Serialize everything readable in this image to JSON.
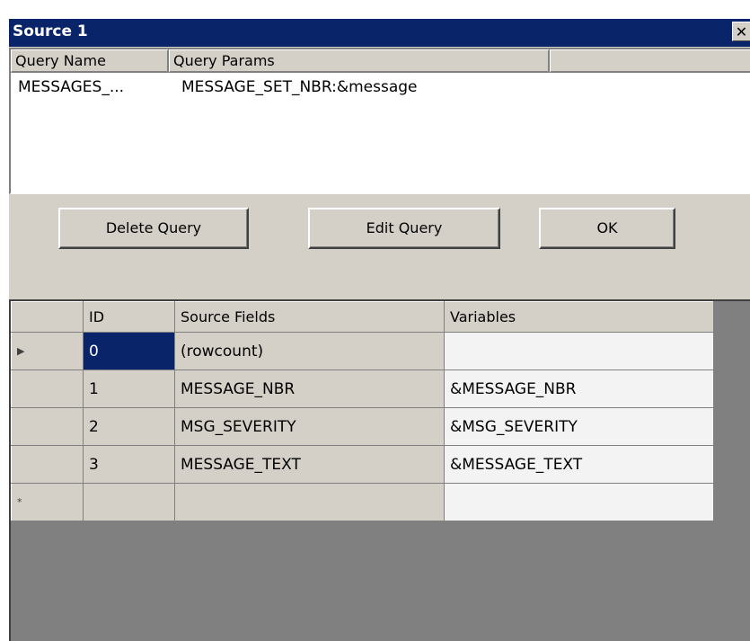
{
  "window": {
    "title": "Source 1",
    "close_glyph": "✕"
  },
  "query_list": {
    "columns": [
      "Query Name",
      "Query Params",
      ""
    ],
    "rows": [
      {
        "name": "MESSAGES_...",
        "params": "MESSAGE_SET_NBR:&message"
      }
    ]
  },
  "buttons": {
    "delete_query": "Delete Query",
    "edit_query": "Edit Query",
    "ok": "OK"
  },
  "grid": {
    "columns": [
      "",
      "ID",
      "Source Fields",
      "Variables"
    ],
    "rows": [
      {
        "marker": "▶",
        "marker_icon": "current-row-arrow-icon",
        "id": "0",
        "source": "(rowcount)",
        "variable": ""
      },
      {
        "marker": "",
        "id": "1",
        "source": "MESSAGE_NBR",
        "variable": "&MESSAGE_NBR"
      },
      {
        "marker": "",
        "id": "2",
        "source": "MSG_SEVERITY",
        "variable": "&MSG_SEVERITY"
      },
      {
        "marker": "",
        "id": "3",
        "source": "MESSAGE_TEXT",
        "variable": "&MESSAGE_TEXT"
      },
      {
        "marker": "*",
        "marker_icon": "new-row-asterisk-icon",
        "id": "",
        "source": "",
        "variable": ""
      }
    ]
  },
  "colors": {
    "title_bar": "#0a246a",
    "face": "#d4d0c8",
    "grid_background": "#808080",
    "selection": "#0a246a"
  }
}
